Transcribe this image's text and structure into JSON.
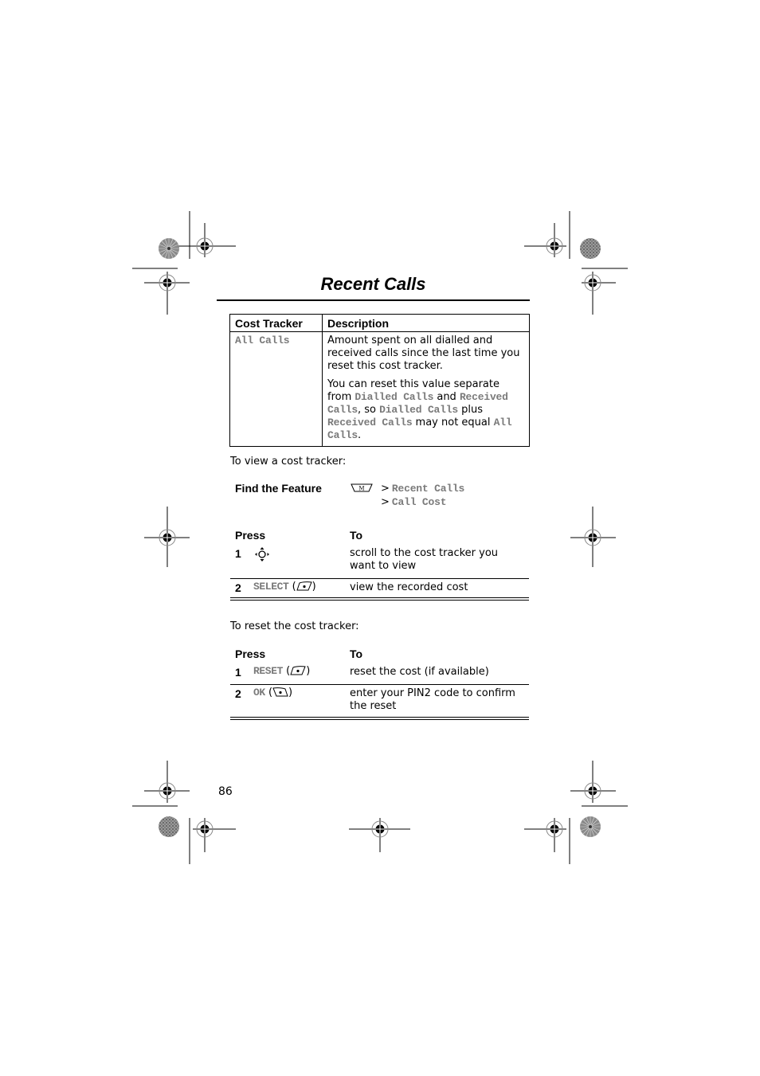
{
  "page": {
    "title": "Recent Calls",
    "page_number": "86"
  },
  "cost_tracker_table": {
    "headers": [
      "Cost Tracker",
      "Description"
    ],
    "rows": [
      {
        "tracker": "All Calls",
        "description": {
          "para1": "Amount spent on all dialled and received calls since the last time you reset this cost tracker.",
          "para2": {
            "t1": "You can reset this value separate from ",
            "dialled_calls_1": "Dialled Calls",
            "t2": " and ",
            "received_calls_1": "Received Calls",
            "t3": ", so ",
            "dialled_calls_2": "Dialled Calls",
            "t4": " plus ",
            "received_calls_2": "Received Calls",
            "t5": " may not equal ",
            "all_calls": "All Calls",
            "t6": "."
          }
        }
      }
    ]
  },
  "view_intro": "To view a cost tracker:",
  "find_feature": {
    "label": "Find the Feature",
    "menu_key_icon": "menu-key-icon",
    "menu_key_letter": "M",
    "path": [
      {
        "sep": ">",
        "item": "Recent Calls"
      },
      {
        "sep": ">",
        "item": "Call Cost"
      }
    ]
  },
  "view_steps": {
    "headers": {
      "press": "Press",
      "to": "To"
    },
    "steps": [
      {
        "num": "1",
        "press_icon": "navigation-key-icon",
        "to": "scroll to the cost tracker you want to view"
      },
      {
        "num": "2",
        "press_key": "SELECT",
        "press_icon": "right-soft-key-icon",
        "to": "view the recorded cost"
      }
    ]
  },
  "reset_intro": "To reset the cost tracker:",
  "reset_steps": {
    "headers": {
      "press": "Press",
      "to": "To"
    },
    "steps": [
      {
        "num": "1",
        "press_key": "RESET",
        "press_icon": "right-soft-key-icon",
        "to": "reset the cost (if available)"
      },
      {
        "num": "2",
        "press_key": "OK",
        "press_icon": "left-soft-key-icon",
        "to": "enter your PIN2 code to confirm the reset"
      }
    ]
  },
  "paren_open": "(",
  "paren_close": ")",
  "colors": {
    "text": "#000000",
    "display_text": "#7a7a7a",
    "background": "#ffffff"
  }
}
